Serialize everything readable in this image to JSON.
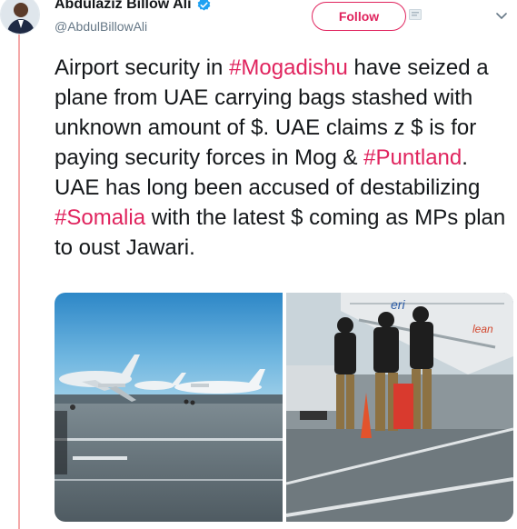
{
  "author": {
    "display_name": "Abdulaziz Billow Ali",
    "handle": "@AbdulBillowAli",
    "verified": true,
    "avatar_icon": "profile-photo"
  },
  "header": {
    "follow_label": "Follow",
    "follow_color": "#e0245e",
    "reply_icon": "reply-icon",
    "menu_icon": "chevron-down-icon"
  },
  "tweet": {
    "segments": [
      {
        "text": "Airport security in ",
        "type": "text"
      },
      {
        "text": "#Mogadishu",
        "type": "hashtag"
      },
      {
        "text": " have seized a plane from UAE carrying bags stashed with unknown amount of $. UAE claims z $ is for paying security forces in Mog & ",
        "type": "text"
      },
      {
        "text": "#Puntland",
        "type": "hashtag"
      },
      {
        "text": ". UAE has long been accused of destabilizing ",
        "type": "text"
      },
      {
        "text": "#Somalia",
        "type": "hashtag"
      },
      {
        "text": " with the latest $ coming as MPs plan to oust Jawari.",
        "type": "text"
      }
    ]
  },
  "media": {
    "photos": [
      {
        "description_icon": "airport-tarmac-photo"
      },
      {
        "description_icon": "security-guards-photo"
      }
    ]
  },
  "colors": {
    "hashtag": "#e0245e",
    "thread_line": "#f4a9a9",
    "text": "#14171a",
    "muted": "#657786",
    "verified": "#1da1f2"
  }
}
